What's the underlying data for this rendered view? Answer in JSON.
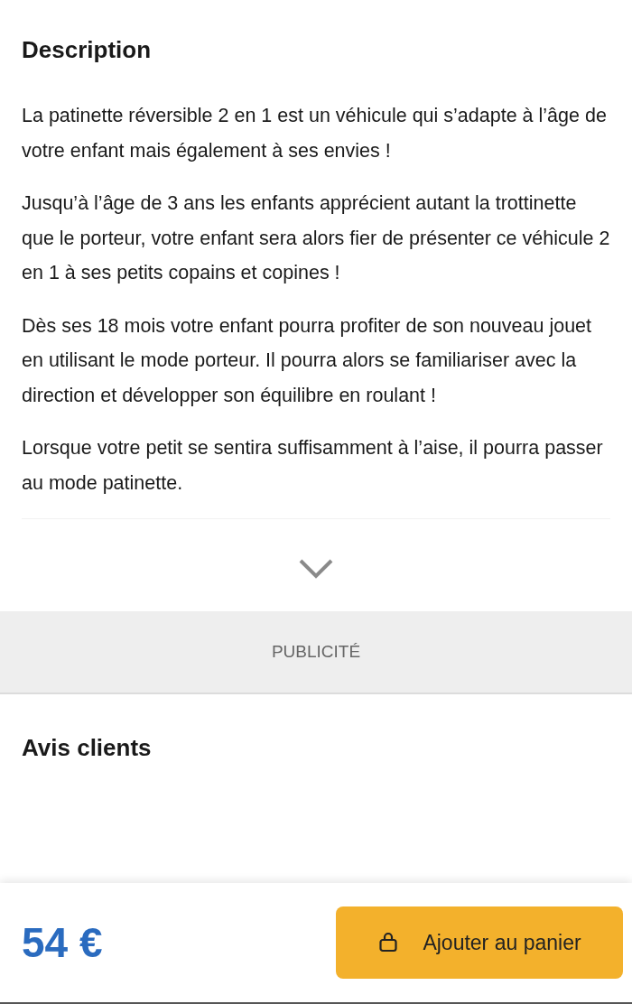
{
  "description": {
    "title": "Description",
    "paragraphs": [
      "La patinette réversible 2 en 1 est un véhicule qui s’adapte à l’âge de votre enfant mais également à ses envies !",
      "Jusqu’à l’âge de 3 ans les enfants apprécient autant la trottinette que le porteur, votre enfant sera alors fier de présenter ce véhicule 2 en 1 à ses petits copains et copines !",
      "Dès ses 18 mois votre enfant pourra profiter de son nouveau jouet en utilisant le mode porteur. Il pourra alors se familiariser avec la direction et développer son équilibre en roulant !",
      "Lorsque votre petit se sentira suffisamment à l’aise, il pourra passer au mode patinette."
    ],
    "expanded": false
  },
  "ad": {
    "label": "PUBLICITÉ"
  },
  "reviews": {
    "title": "Avis clients"
  },
  "footer": {
    "price": "54 €",
    "button": "Ajouter au panier"
  }
}
